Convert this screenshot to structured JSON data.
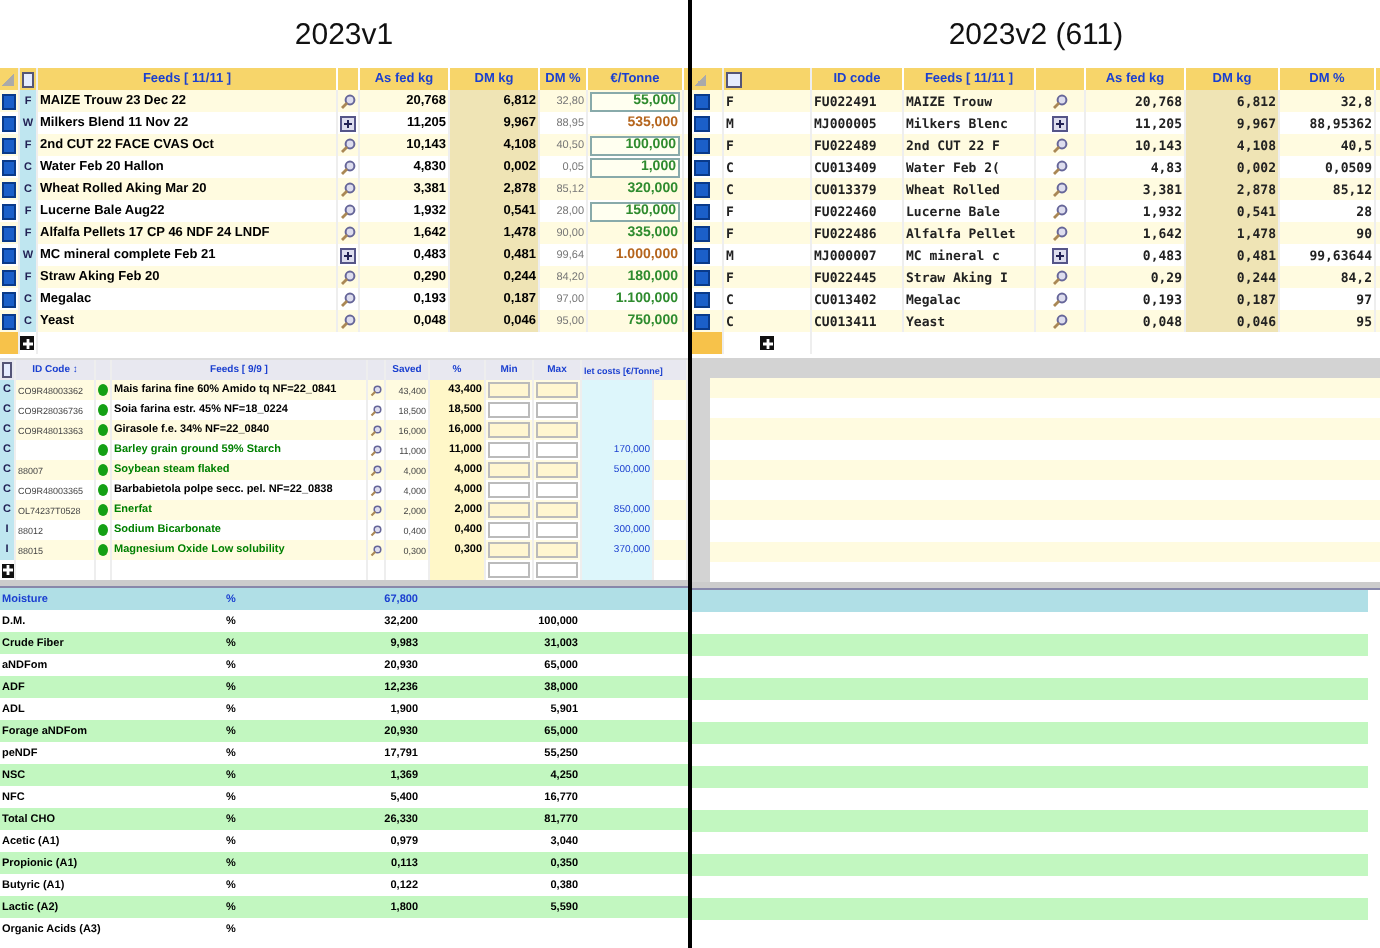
{
  "left": {
    "title": "2023v1",
    "feeds_table": {
      "columns": [
        "Feeds   [ 11/11 ]",
        "As fed kg",
        "DM kg",
        "DM %",
        "€/Tonne"
      ],
      "rows": [
        {
          "checked": true,
          "type": "F",
          "name": "MAIZE Trouw 23 Dec 22",
          "kind": "search",
          "as_fed": "20,768",
          "dm_kg": "6,812",
          "dm_pct": "32,80",
          "price": "55,000",
          "color": "#2e8b2e",
          "editable": true
        },
        {
          "checked": true,
          "type": "W",
          "name": "Milkers Blend 11 Nov 22",
          "kind": "mix",
          "as_fed": "11,205",
          "dm_kg": "9,967",
          "dm_pct": "88,95",
          "price": "535,000",
          "color": "#b5651d",
          "editable": false
        },
        {
          "checked": true,
          "type": "F",
          "name": "2nd CUT 22 FACE CVAS Oct",
          "kind": "search",
          "as_fed": "10,143",
          "dm_kg": "4,108",
          "dm_pct": "40,50",
          "price": "100,000",
          "color": "#2e8b2e",
          "editable": true
        },
        {
          "checked": true,
          "type": "C",
          "name": "Water Feb 20 Hallon",
          "kind": "search",
          "as_fed": "4,830",
          "dm_kg": "0,002",
          "dm_pct": "0,05",
          "price": "1,000",
          "color": "#2e8b2e",
          "editable": true
        },
        {
          "checked": true,
          "type": "C",
          "name": "Wheat Rolled Aking Mar 20",
          "kind": "search",
          "as_fed": "3,381",
          "dm_kg": "2,878",
          "dm_pct": "85,12",
          "price": "320,000",
          "color": "#2e8b2e",
          "editable": false
        },
        {
          "checked": true,
          "type": "F",
          "name": "Lucerne Bale Aug22",
          "kind": "search",
          "as_fed": "1,932",
          "dm_kg": "0,541",
          "dm_pct": "28,00",
          "price": "150,000",
          "color": "#2e8b2e",
          "editable": true
        },
        {
          "checked": true,
          "type": "F",
          "name": "Alfalfa Pellets 17 CP 46 NDF 24 LNDF",
          "kind": "search",
          "as_fed": "1,642",
          "dm_kg": "1,478",
          "dm_pct": "90,00",
          "price": "335,000",
          "color": "#2e8b2e",
          "editable": false
        },
        {
          "checked": true,
          "type": "W",
          "name": "MC mineral complete Feb 21",
          "kind": "mix",
          "as_fed": "0,483",
          "dm_kg": "0,481",
          "dm_pct": "99,64",
          "price": "1.000,000",
          "color": "#b5651d",
          "editable": false
        },
        {
          "checked": true,
          "type": "F",
          "name": "Straw Aking Feb 20",
          "kind": "search",
          "as_fed": "0,290",
          "dm_kg": "0,244",
          "dm_pct": "84,20",
          "price": "180,000",
          "color": "#2e8b2e",
          "editable": false
        },
        {
          "checked": true,
          "type": "C",
          "name": "Megalac",
          "kind": "search",
          "as_fed": "0,193",
          "dm_kg": "0,187",
          "dm_pct": "97,00",
          "price": "1.100,000",
          "color": "#2e8b2e",
          "editable": false
        },
        {
          "checked": true,
          "type": "C",
          "name": "Yeast",
          "kind": "search",
          "as_fed": "0,048",
          "dm_kg": "0,046",
          "dm_pct": "95,00",
          "price": "750,000",
          "color": "#2e8b2e",
          "editable": false
        }
      ]
    },
    "ingredients_table": {
      "columns": [
        "ID Code ↕",
        "Feeds  [ 9/9 ]",
        "Saved",
        "%",
        "Min",
        "Max",
        "let costs [€/Tonne]"
      ],
      "rows": [
        {
          "type": "C",
          "id": "CO9R48003362",
          "name": "Mais farina fine 60% Amido tq NF=22_0841",
          "color": "#000000",
          "saved": "43,400",
          "pct": "43,400",
          "cost": ""
        },
        {
          "type": "C",
          "id": "CO9R28036736",
          "name": "Soia farina estr. 45% NF=18_0224",
          "color": "#000000",
          "saved": "18,500",
          "pct": "18,500",
          "cost": ""
        },
        {
          "type": "C",
          "id": "CO9R48013363",
          "name": "Girasole f.e. 34%  NF=22_0840",
          "color": "#000000",
          "saved": "16,000",
          "pct": "16,000",
          "cost": ""
        },
        {
          "type": "C",
          "id": "",
          "name": "Barley grain ground 59% Starch",
          "color": "#008000",
          "saved": "11,000",
          "pct": "11,000",
          "cost": "170,000"
        },
        {
          "type": "C",
          "id": "88007",
          "name": "Soybean steam flaked",
          "color": "#008000",
          "saved": "4,000",
          "pct": "4,000",
          "cost": "500,000"
        },
        {
          "type": "C",
          "id": "CO9R48003365",
          "name": "Barbabietola polpe secc. pel. NF=22_0838",
          "color": "#000000",
          "saved": "4,000",
          "pct": "4,000",
          "cost": ""
        },
        {
          "type": "C",
          "id": "OL74237T0528",
          "name": "Enerfat",
          "color": "#008000",
          "saved": "2,000",
          "pct": "2,000",
          "cost": "850,000"
        },
        {
          "type": "I",
          "id": "88012",
          "name": "Sodium Bicarbonate",
          "color": "#008000",
          "saved": "0,400",
          "pct": "0,400",
          "cost": "300,000"
        },
        {
          "type": "I",
          "id": "88015",
          "name": "Magnesium Oxide Low solubility",
          "color": "#008000",
          "saved": "0,300",
          "pct": "0,300",
          "cost": "370,000"
        }
      ]
    },
    "nutrients_table": {
      "rows": [
        {
          "name": "Moisture",
          "unit": "%",
          "value": "67,800",
          "dm_value": "",
          "selected": true
        },
        {
          "name": "D.M.",
          "unit": "%",
          "value": "32,200",
          "dm_value": "100,000",
          "selected": false
        },
        {
          "name": "Crude Fiber",
          "unit": "%",
          "value": "9,983",
          "dm_value": "31,003",
          "selected": false
        },
        {
          "name": "aNDFom",
          "unit": "%",
          "value": "20,930",
          "dm_value": "65,000",
          "selected": false
        },
        {
          "name": "ADF",
          "unit": "%",
          "value": "12,236",
          "dm_value": "38,000",
          "selected": false
        },
        {
          "name": "ADL",
          "unit": "%",
          "value": "1,900",
          "dm_value": "5,901",
          "selected": false
        },
        {
          "name": "Forage aNDFom",
          "unit": "%",
          "value": "20,930",
          "dm_value": "65,000",
          "selected": false
        },
        {
          "name": "peNDF",
          "unit": "%",
          "value": "17,791",
          "dm_value": "55,250",
          "selected": false
        },
        {
          "name": "NSC",
          "unit": "%",
          "value": "1,369",
          "dm_value": "4,250",
          "selected": false
        },
        {
          "name": "NFC",
          "unit": "%",
          "value": "5,400",
          "dm_value": "16,770",
          "selected": false
        },
        {
          "name": "Total CHO",
          "unit": "%",
          "value": "26,330",
          "dm_value": "81,770",
          "selected": false
        },
        {
          "name": "Acetic (A1)",
          "unit": "%",
          "value": "0,979",
          "dm_value": "3,040",
          "selected": false
        },
        {
          "name": "Propionic (A1)",
          "unit": "%",
          "value": "0,113",
          "dm_value": "0,350",
          "selected": false
        },
        {
          "name": "Butyric (A1)",
          "unit": "%",
          "value": "0,122",
          "dm_value": "0,380",
          "selected": false
        },
        {
          "name": "Lactic (A2)",
          "unit": "%",
          "value": "1,800",
          "dm_value": "5,590",
          "selected": false
        },
        {
          "name": "Organic Acids (A3)",
          "unit": "%",
          "value": "",
          "dm_value": "",
          "selected": false
        }
      ]
    }
  },
  "right": {
    "title": "2023v2 (611)",
    "feeds_table": {
      "columns": [
        "ID code",
        "Feeds   [ 11/11 ]",
        "As fed kg",
        "DM kg",
        "DM %"
      ],
      "rows": [
        {
          "checked": true,
          "type": "F",
          "id": "FU022491",
          "name": "MAIZE Trouw",
          "kind": "search",
          "as_fed": "20,768",
          "dm_kg": "6,812",
          "dm_pct": "32,8"
        },
        {
          "checked": true,
          "type": "M",
          "id": "MJ000005",
          "name": "Milkers Blenc",
          "kind": "mix",
          "as_fed": "11,205",
          "dm_kg": "9,967",
          "dm_pct": "88,95362"
        },
        {
          "checked": true,
          "type": "F",
          "id": "FU022489",
          "name": "2nd CUT 22 F",
          "kind": "search",
          "as_fed": "10,143",
          "dm_kg": "4,108",
          "dm_pct": "40,5"
        },
        {
          "checked": true,
          "type": "C",
          "id": "CU013409",
          "name": "Water Feb 2(",
          "kind": "search",
          "as_fed": "4,83",
          "dm_kg": "0,002",
          "dm_pct": "0,0509"
        },
        {
          "checked": true,
          "type": "C",
          "id": "CU013379",
          "name": "Wheat Rolled",
          "kind": "search",
          "as_fed": "3,381",
          "dm_kg": "2,878",
          "dm_pct": "85,12"
        },
        {
          "checked": true,
          "type": "F",
          "id": "FU022460",
          "name": "Lucerne Bale",
          "kind": "search",
          "as_fed": "1,932",
          "dm_kg": "0,541",
          "dm_pct": "28"
        },
        {
          "checked": true,
          "type": "F",
          "id": "FU022486",
          "name": "Alfalfa Pellet",
          "kind": "search",
          "as_fed": "1,642",
          "dm_kg": "1,478",
          "dm_pct": "90"
        },
        {
          "checked": true,
          "type": "M",
          "id": "MJ000007",
          "name": "MC mineral c",
          "kind": "mix",
          "as_fed": "0,483",
          "dm_kg": "0,481",
          "dm_pct": "99,63644"
        },
        {
          "checked": true,
          "type": "F",
          "id": "FU022445",
          "name": "Straw Aking I",
          "kind": "search",
          "as_fed": "0,29",
          "dm_kg": "0,244",
          "dm_pct": "84,2"
        },
        {
          "checked": true,
          "type": "C",
          "id": "CU013402",
          "name": "Megalac",
          "kind": "search",
          "as_fed": "0,193",
          "dm_kg": "0,187",
          "dm_pct": "97"
        },
        {
          "checked": true,
          "type": "C",
          "id": "CU013411",
          "name": "Yeast",
          "kind": "search",
          "as_fed": "0,048",
          "dm_kg": "0,046",
          "dm_pct": "95"
        }
      ]
    }
  }
}
